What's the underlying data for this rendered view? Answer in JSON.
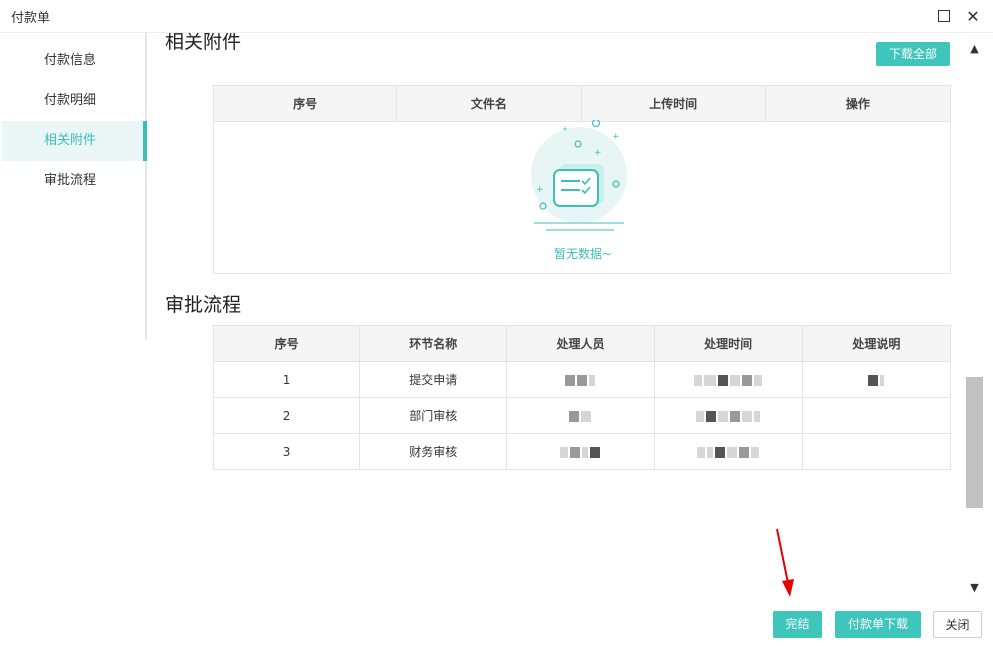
{
  "window": {
    "title": "付款单"
  },
  "sidebar": {
    "items": [
      {
        "label": "付款信息"
      },
      {
        "label": "付款明细"
      },
      {
        "label": "相关附件",
        "active": true
      },
      {
        "label": "审批流程"
      }
    ]
  },
  "attachments": {
    "title": "相关附件",
    "download_all": "下载全部",
    "columns": [
      "序号",
      "文件名",
      "上传时间",
      "操作"
    ],
    "empty_text": "暂无数据~"
  },
  "approval": {
    "title": "审批流程",
    "columns": [
      "序号",
      "环节名称",
      "处理人员",
      "处理时间",
      "处理说明"
    ],
    "rows": [
      {
        "no": "1",
        "step": "提交申请"
      },
      {
        "no": "2",
        "step": "部门审核"
      },
      {
        "no": "3",
        "step": "财务审核"
      }
    ]
  },
  "footer": {
    "done": "完结",
    "download": "付款单下载",
    "close": "关闭"
  },
  "colors": {
    "accent": "#3ec6bd",
    "annotation_arrow": "#e60000"
  }
}
